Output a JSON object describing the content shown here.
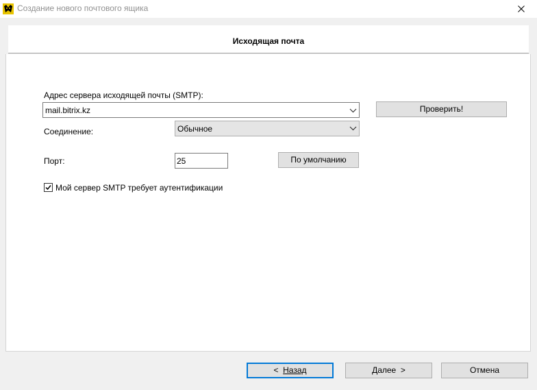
{
  "window": {
    "title": "Создание нового почтового ящика"
  },
  "header": {
    "title": "Исходящая почта"
  },
  "form": {
    "smtp_label": "Адрес сервера исходящей почты (SMTP):",
    "smtp_value": "mail.bitrix.kz",
    "check_button": "Проверить!",
    "connection_label": "Соединение:",
    "connection_value": "Обычное",
    "port_label": "Порт:",
    "port_value": "25",
    "default_button": "По умолчанию",
    "auth_checked": true,
    "auth_label": "Мой сервер SMTP требует аутентификации"
  },
  "footer": {
    "back_arrow": "<",
    "back_label": "Назад",
    "next_label": "Далее",
    "next_arrow": ">",
    "cancel_label": "Отмена"
  },
  "colors": {
    "focus_border": "#0078d7",
    "button_bg": "#e1e1e1",
    "window_bg": "#f0f0f0"
  }
}
